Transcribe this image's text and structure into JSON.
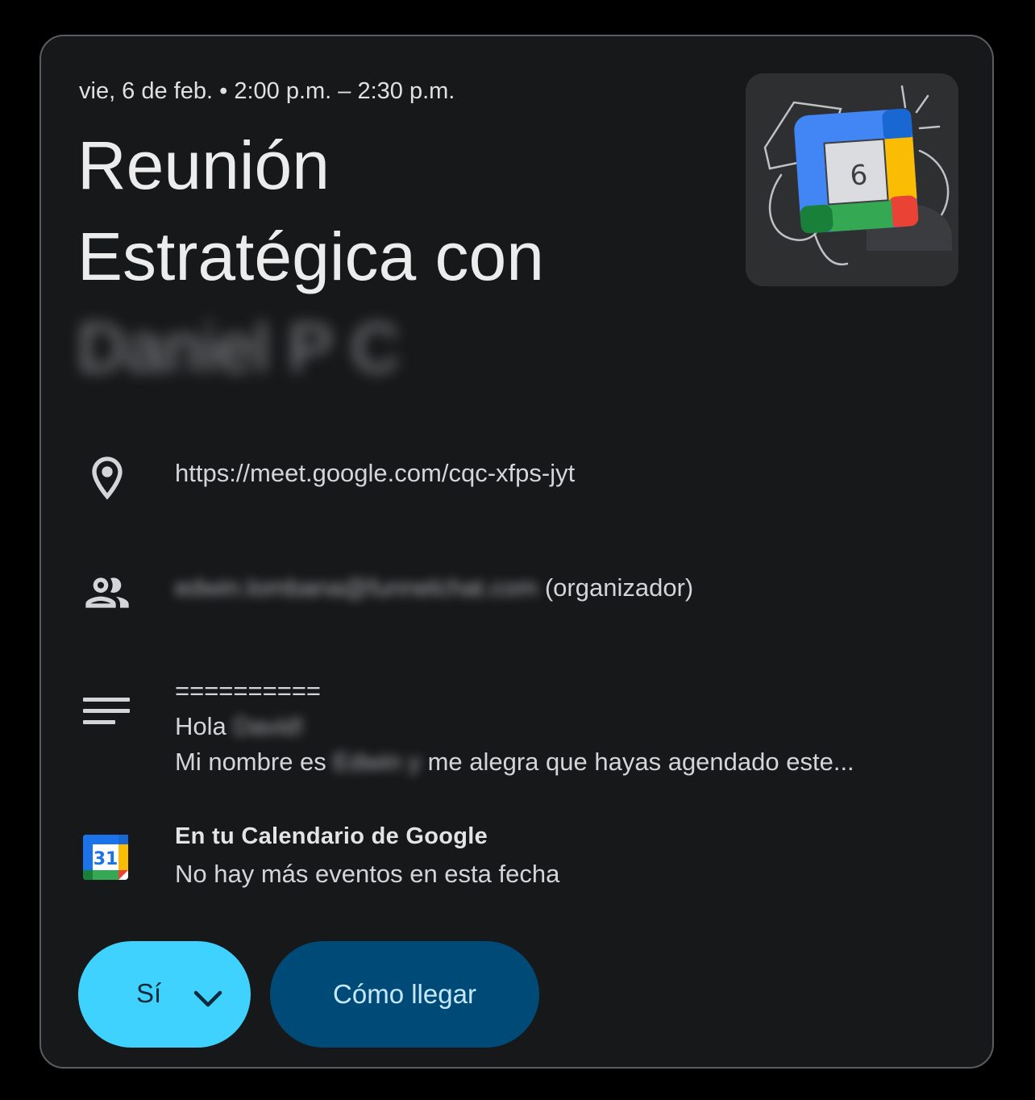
{
  "event": {
    "datetime": "vie, 6 de feb. • 2:00 p.m. – 2:30 p.m.",
    "title_line1": "Reunión",
    "title_line2": "Estratégica con",
    "title_line3_redacted": "Daniel P C"
  },
  "illustration": {
    "day_number": "6",
    "icon": "calendar-illustration"
  },
  "location": {
    "icon": "location-pin-icon",
    "text": "https://meet.google.com/cqc-xfps-jyt"
  },
  "organizer": {
    "icon": "people-icon",
    "email_redacted": "edwin.lombana@funnelchat.com",
    "suffix": "(organizador)"
  },
  "description": {
    "icon": "notes-icon",
    "line1": "==========",
    "line2_prefix": "Hola ",
    "line2_redacted": "David!",
    "line3_prefix": "Mi nombre es ",
    "line3_redacted": "Edwin y",
    "line3_suffix": " me alegra que hayas agendado este..."
  },
  "calendar_info": {
    "icon": "google-calendar-icon",
    "icon_day": "31",
    "title": "En tu Calendario de Google",
    "subtitle": "No hay más eventos en esta fecha"
  },
  "actions": {
    "rsvp_label": "Sí",
    "directions_label": "Cómo llegar"
  },
  "colors": {
    "background": "#17181a",
    "rsvp_button": "#3fd2ff",
    "directions_button": "#004a77",
    "google_blue": "#1a73e8",
    "google_green": "#1e8e3e",
    "google_yellow": "#fbbc04",
    "google_red": "#ea4335"
  }
}
